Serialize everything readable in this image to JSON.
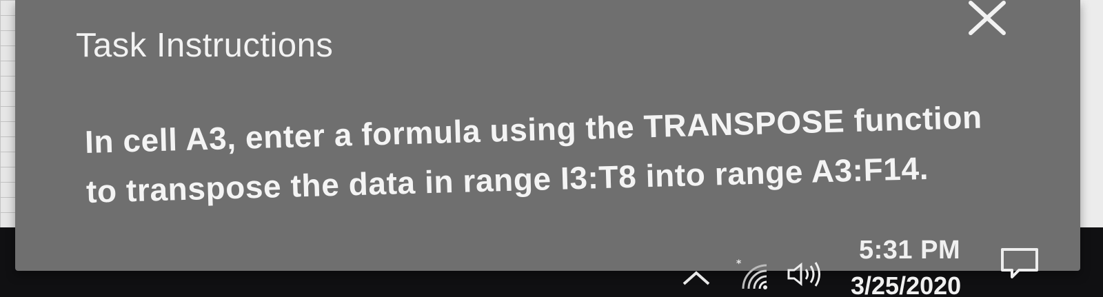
{
  "task_panel": {
    "title": "Task Instructions",
    "instruction_line1": "In cell A3, enter a formula using the TRANSPOSE function",
    "instruction_line2": "to transpose the data in range I3:T8 into range A3:F14.",
    "close_icon": "close-icon"
  },
  "taskbar": {
    "clock": {
      "time": "5:31 PM",
      "date": "3/25/2020"
    },
    "icons": [
      "chevron-up-icon",
      "network-icon",
      "volume-icon",
      "action-center-icon"
    ]
  },
  "colors": {
    "panel_background": "#6f6f6f",
    "panel_text": "#f4f4f4",
    "taskbar_background": "#101012"
  }
}
